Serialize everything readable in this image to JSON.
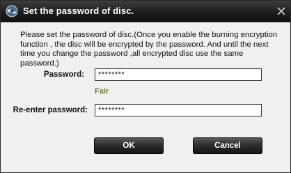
{
  "dialog": {
    "title": "Set the password of disc.",
    "message": "Please set the password of disc.(Once you enable the burning encryption function , the disc will be encrypted by the password. And until the next time you change the password ,all encrypted disc use the same password.)",
    "password_label": "Password:",
    "password_value": "********",
    "strength_text": "Fair",
    "reenter_label": "Re-enter password:",
    "reenter_value": "********",
    "ok_label": "OK",
    "cancel_label": "Cancel",
    "app_icon": "disc-globe-icon",
    "close_icon": "close-icon",
    "strength_color": "#6b7b2a"
  }
}
